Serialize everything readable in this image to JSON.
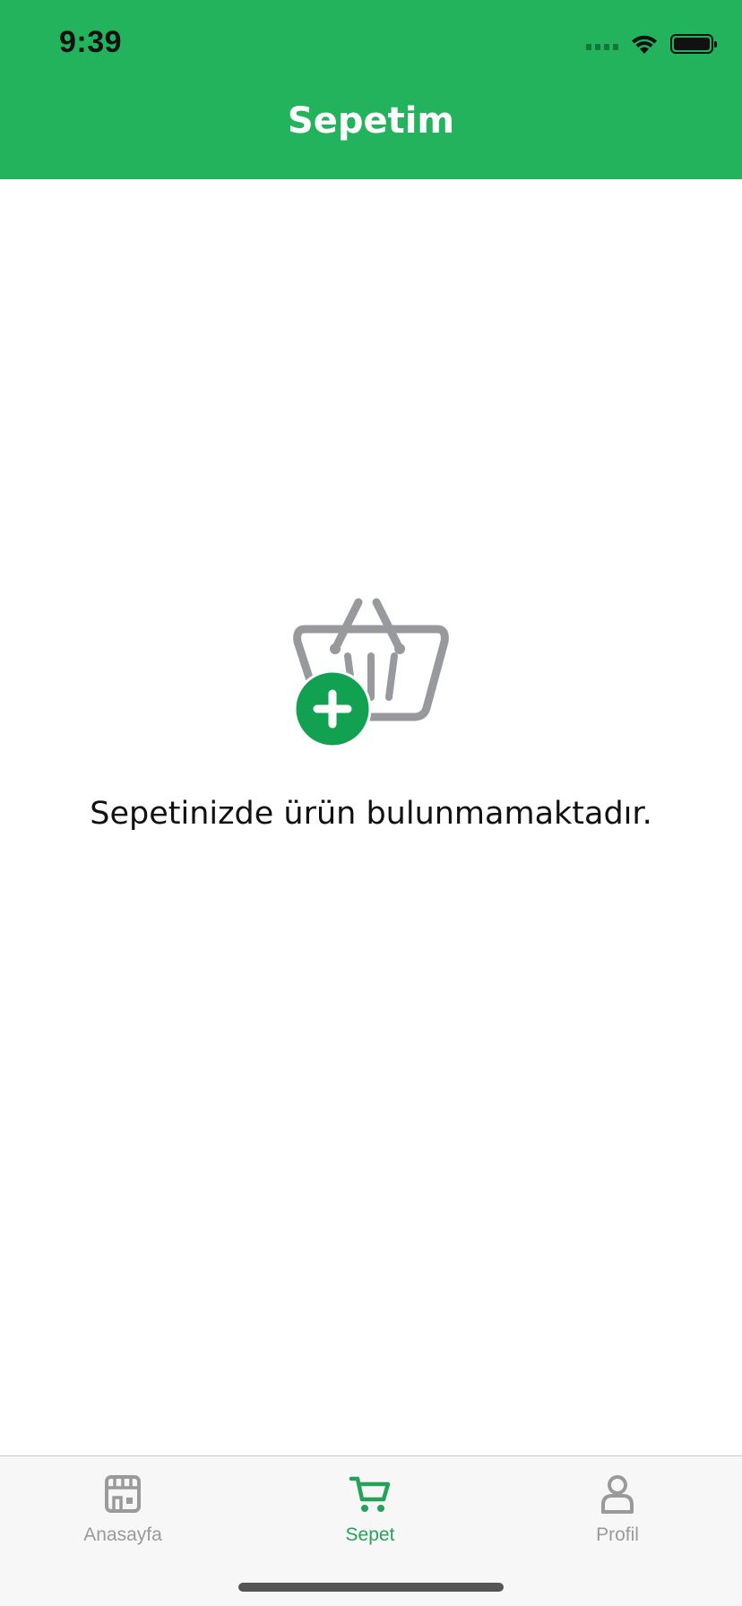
{
  "status_bar": {
    "time": "9:39"
  },
  "header": {
    "title": "Sepetim",
    "background_color": "#23b35c"
  },
  "empty_state": {
    "icon": "shopping-basket-add-icon",
    "message": "Sepetinizde ürün bulunmamaktadır.",
    "accent_color": "#12a150"
  },
  "tab_bar": {
    "active_color": "#23a357",
    "inactive_color": "#9a9a9a",
    "items": [
      {
        "label": "Anasayfa",
        "icon": "store-icon",
        "active": false
      },
      {
        "label": "Sepet",
        "icon": "cart-icon",
        "active": true
      },
      {
        "label": "Profil",
        "icon": "user-icon",
        "active": false
      }
    ]
  }
}
